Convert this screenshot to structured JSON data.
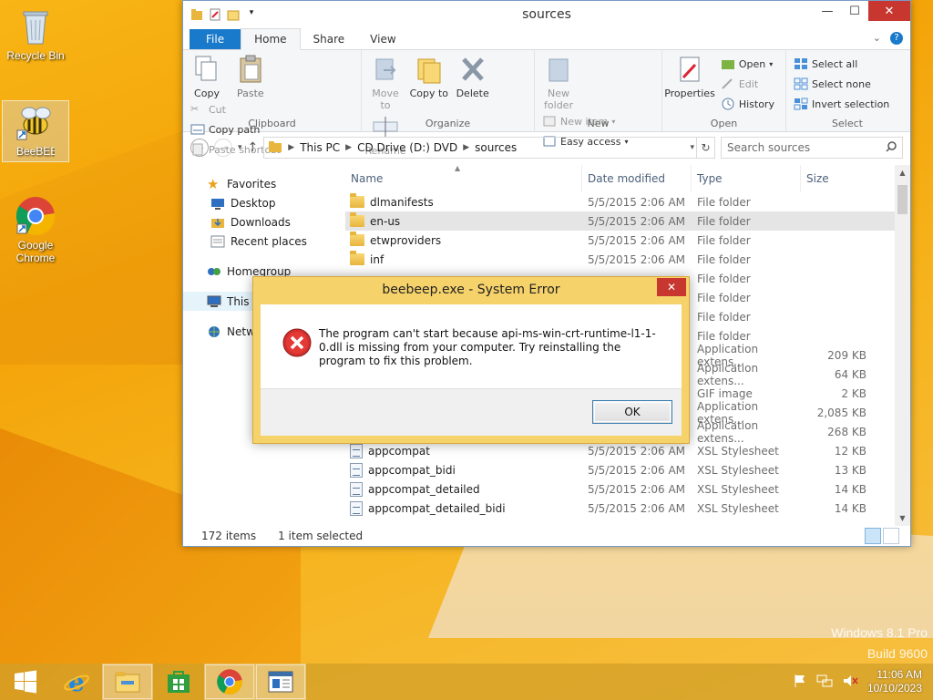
{
  "desktop": {
    "icons": [
      {
        "label": "Recycle Bin"
      },
      {
        "label": "BeeBEEP"
      },
      {
        "label": "Google Chrome"
      }
    ],
    "watermark": {
      "line1": "Windows 8.1 Pro",
      "line2": "Build 9600"
    }
  },
  "explorer": {
    "title": "sources",
    "tabs": {
      "file": "File",
      "home": "Home",
      "share": "Share",
      "view": "View"
    },
    "ribbon": {
      "clipboard": {
        "copy": "Copy",
        "paste": "Paste",
        "cut": "Cut",
        "copy_path": "Copy path",
        "paste_shortcut": "Paste shortcut",
        "group": "Clipboard"
      },
      "organize": {
        "move_to": "Move to",
        "copy_to": "Copy to",
        "delete": "Delete",
        "rename": "Rename",
        "group": "Organize"
      },
      "new": {
        "new_folder": "New folder",
        "new_item": "New item",
        "easy_access": "Easy access",
        "group": "New"
      },
      "open": {
        "properties": "Properties",
        "open": "Open",
        "edit": "Edit",
        "history": "History",
        "group": "Open"
      },
      "select": {
        "select_all": "Select all",
        "select_none": "Select none",
        "invert": "Invert selection",
        "group": "Select"
      }
    },
    "address": {
      "crumbs": [
        "This PC",
        "CD Drive (D:) DVD",
        "sources"
      ]
    },
    "search": {
      "placeholder": "Search sources"
    },
    "nav": {
      "favorites": "Favorites",
      "desktop": "Desktop",
      "downloads": "Downloads",
      "recent": "Recent places",
      "homegroup": "Homegroup",
      "this_pc": "This PC",
      "network": "Network"
    },
    "columns": {
      "name": "Name",
      "date": "Date modified",
      "type": "Type",
      "size": "Size"
    },
    "files": [
      {
        "name": "dlmanifests",
        "date": "5/5/2015 2:06 AM",
        "type": "File folder",
        "size": "",
        "kind": "folder"
      },
      {
        "name": "en-us",
        "date": "5/5/2015 2:06 AM",
        "type": "File folder",
        "size": "",
        "kind": "folder"
      },
      {
        "name": "etwproviders",
        "date": "5/5/2015 2:06 AM",
        "type": "File folder",
        "size": "",
        "kind": "folder"
      },
      {
        "name": "inf",
        "date": "5/5/2015 2:06 AM",
        "type": "File folder",
        "size": "",
        "kind": "folder"
      },
      {
        "name": "",
        "date": "",
        "type": "File folder",
        "size": "",
        "kind": "hidden"
      },
      {
        "name": "",
        "date": "",
        "type": "File folder",
        "size": "",
        "kind": "hidden"
      },
      {
        "name": "",
        "date": "",
        "type": "File folder",
        "size": "",
        "kind": "hidden"
      },
      {
        "name": "",
        "date": "",
        "type": "File folder",
        "size": "",
        "kind": "hidden"
      },
      {
        "name": "",
        "date": "",
        "type": "Application extens...",
        "size": "209 KB",
        "kind": "hidden"
      },
      {
        "name": "",
        "date": "",
        "type": "Application extens...",
        "size": "64 KB",
        "kind": "hidden"
      },
      {
        "name": "",
        "date": "",
        "type": "GIF image",
        "size": "2 KB",
        "kind": "hidden"
      },
      {
        "name": "",
        "date": "",
        "type": "Application extens...",
        "size": "2,085 KB",
        "kind": "hidden"
      },
      {
        "name": "",
        "date": "",
        "type": "Application extens...",
        "size": "268 KB",
        "kind": "hidden"
      },
      {
        "name": "appcompat",
        "date": "5/5/2015 2:06 AM",
        "type": "XSL Stylesheet",
        "size": "12 KB",
        "kind": "xsl"
      },
      {
        "name": "appcompat_bidi",
        "date": "5/5/2015 2:06 AM",
        "type": "XSL Stylesheet",
        "size": "13 KB",
        "kind": "xsl"
      },
      {
        "name": "appcompat_detailed",
        "date": "5/5/2015 2:06 AM",
        "type": "XSL Stylesheet",
        "size": "14 KB",
        "kind": "xsl"
      },
      {
        "name": "appcompat_detailed_bidi",
        "date": "5/5/2015 2:06 AM",
        "type": "XSL Stylesheet",
        "size": "14 KB",
        "kind": "xsl"
      }
    ],
    "status": {
      "count": "172 items",
      "selected": "1 item selected"
    }
  },
  "dialog": {
    "title": "beebeep.exe - System Error",
    "message": "The program can't start because api-ms-win-crt-runtime-l1-1-0.dll is missing from your computer. Try reinstalling the program to fix this problem.",
    "ok": "OK"
  },
  "taskbar": {
    "time": "11:06 AM",
    "date": "10/10/2023"
  }
}
